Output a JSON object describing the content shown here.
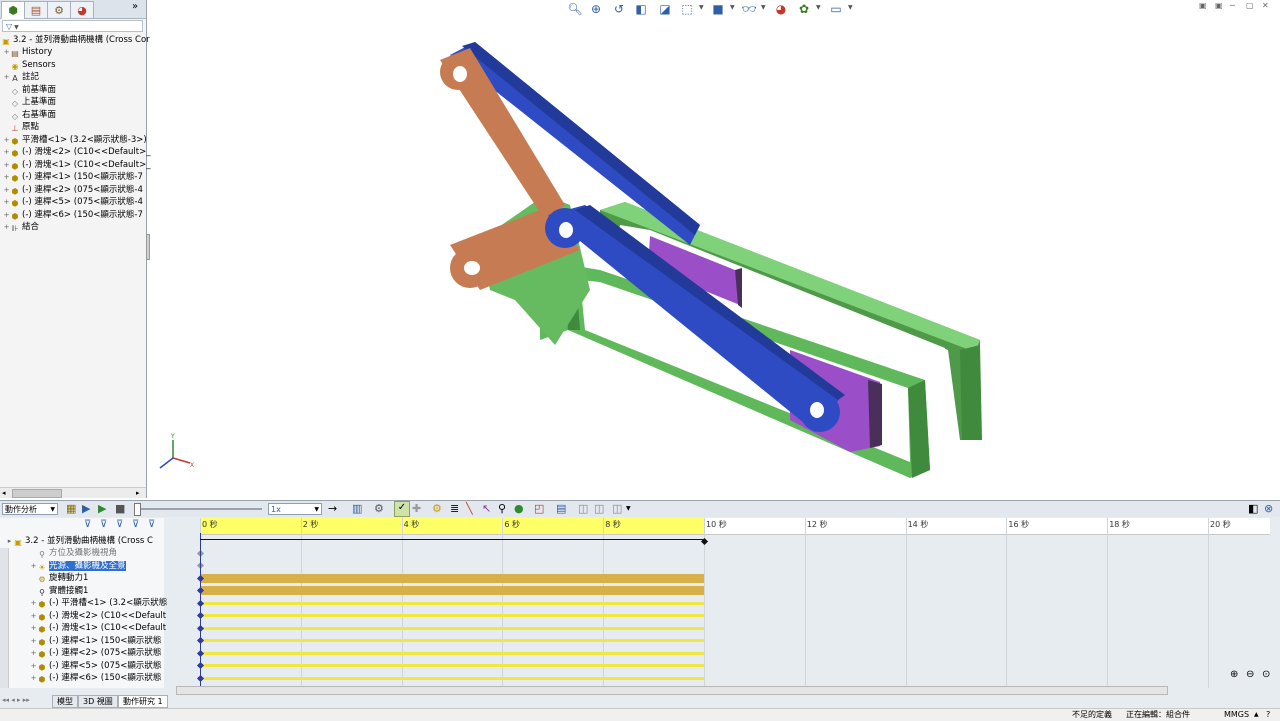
{
  "feature_manager": {
    "filter_symbol": "▽",
    "root": "3.2 - 並列滑動曲柄機構 (Cross Cor",
    "items": [
      {
        "label": "History",
        "icon": "history-icon",
        "indent": 1
      },
      {
        "label": "Sensors",
        "icon": "sensor-icon",
        "indent": 1
      },
      {
        "label": "註記",
        "icon": "annotation-icon",
        "indent": 1
      },
      {
        "label": "前基準面",
        "icon": "plane-icon",
        "indent": 1
      },
      {
        "label": "上基準面",
        "icon": "plane-icon",
        "indent": 1
      },
      {
        "label": "右基準面",
        "icon": "plane-icon",
        "indent": 1
      },
      {
        "label": "原點",
        "icon": "origin-icon",
        "indent": 1
      },
      {
        "label": "平滑槽<1> (3.2<顯示狀態-3>)",
        "icon": "part-icon",
        "indent": 1
      },
      {
        "label": "(-) 滑塊<2> (C10<<Default>_",
        "icon": "part-icon",
        "indent": 1
      },
      {
        "label": "(-) 滑塊<1> (C10<<Default>_",
        "icon": "part-icon",
        "indent": 1
      },
      {
        "label": "(-) 連桿<1> (150<顯示狀態-7",
        "icon": "part-icon",
        "indent": 1
      },
      {
        "label": "(-) 連桿<2> (075<顯示狀態-4",
        "icon": "part-icon",
        "indent": 1
      },
      {
        "label": "(-) 連桿<5> (075<顯示狀態-4",
        "icon": "part-icon",
        "indent": 1
      },
      {
        "label": "(-) 連桿<6> (150<顯示狀態-7",
        "icon": "part-icon",
        "indent": 1
      },
      {
        "label": "結合",
        "icon": "mates-icon",
        "indent": 1
      }
    ]
  },
  "motion": {
    "study_type": "動作分析",
    "time_value": "1x",
    "tree_root": "3.2 - 並列滑動曲柄機構 (Cross C",
    "tree_items": [
      {
        "label": "方位及攝影機視角",
        "icon": "camera-view-icon",
        "bar": "none"
      },
      {
        "label": "光源、攝影機及全景",
        "icon": "lights-icon",
        "bar": "none",
        "selected": true
      },
      {
        "label": "旋轉動力1",
        "icon": "motor-icon",
        "bar": "gold"
      },
      {
        "label": "實體接觸1",
        "icon": "contact-icon",
        "bar": "gold"
      },
      {
        "label": "(-) 平滑槽<1> (3.2<顯示狀態",
        "icon": "part-icon",
        "bar": "yellow"
      },
      {
        "label": "(-) 滑塊<2> (C10<<Default",
        "icon": "part-icon",
        "bar": "yellow"
      },
      {
        "label": "(-) 滑塊<1> (C10<<Default",
        "icon": "part-icon",
        "bar": "yellow"
      },
      {
        "label": "(-) 連桿<1> (150<顯示狀態",
        "icon": "part-icon",
        "bar": "yellow"
      },
      {
        "label": "(-) 連桿<2> (075<顯示狀態",
        "icon": "part-icon",
        "bar": "yellow"
      },
      {
        "label": "(-) 連桿<5> (075<顯示狀態",
        "icon": "part-icon",
        "bar": "yellow"
      },
      {
        "label": "(-) 連桿<6> (150<顯示狀態",
        "icon": "part-icon",
        "bar": "yellow"
      }
    ],
    "ruler": [
      "0 秒",
      "2 秒",
      "4 秒",
      "6 秒",
      "8 秒",
      "10 秒",
      "12 秒",
      "14 秒",
      "16 秒",
      "18 秒",
      "20 秒"
    ],
    "tabs": [
      "模型",
      "3D 視圖",
      "動作研究 1"
    ]
  },
  "status": {
    "definition": "不足的定義",
    "editing": "正在編輯：組合件",
    "units": "MMGS"
  },
  "colors": {
    "link_orange": "#c77b52",
    "link_blue": "#2f4bc4",
    "frame_green": "#63b85e",
    "slider_purple": "#9a4fc8",
    "timeline_yellow": "#ffff66",
    "bar_gold": "#d8b04a"
  }
}
